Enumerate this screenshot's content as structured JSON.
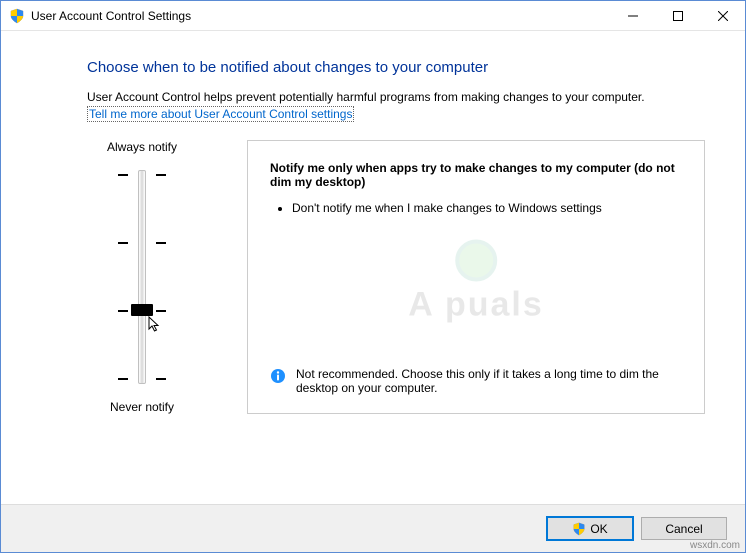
{
  "window": {
    "title": "User Account Control Settings"
  },
  "content": {
    "heading": "Choose when to be notified about changes to your computer",
    "description": "User Account Control helps prevent potentially harmful programs from making changes to your computer.",
    "help_link": "Tell me more about User Account Control settings"
  },
  "slider": {
    "top_label": "Always notify",
    "bottom_label": "Never notify",
    "levels": 4,
    "current_level": 1
  },
  "panel": {
    "title": "Notify me only when apps try to make changes to my computer (do not dim my desktop)",
    "bullets": [
      "Don't notify me when I make changes to Windows settings"
    ],
    "recommendation": "Not recommended. Choose this only if it takes a long time to dim the desktop on your computer."
  },
  "buttons": {
    "ok": "OK",
    "cancel": "Cancel"
  },
  "watermark": "A   puals",
  "source": "wsxdn.com"
}
